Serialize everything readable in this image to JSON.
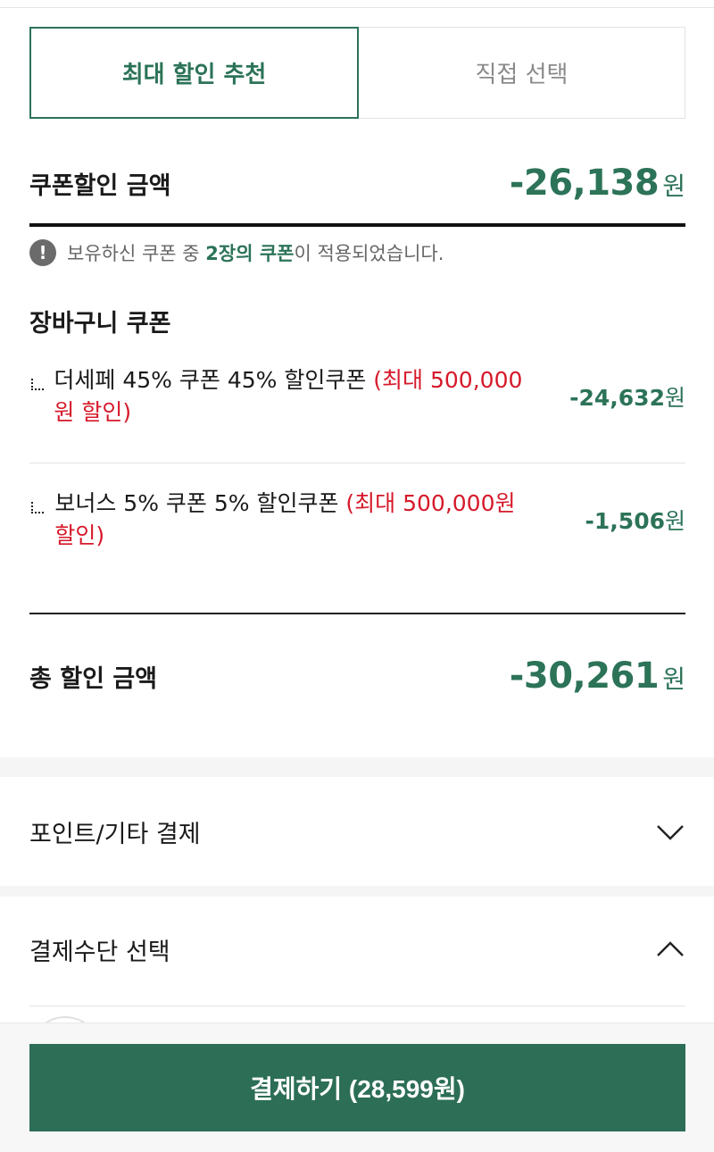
{
  "tabs": [
    {
      "label": "최대 할인 추천",
      "active": true
    },
    {
      "label": "직접 선택",
      "active": false
    }
  ],
  "coupon_discount": {
    "label": "쿠폰할인 금액",
    "amount": "-26,138",
    "unit": "원"
  },
  "notice": {
    "prefix": "보유하신 쿠폰 중 ",
    "highlight": "2장의 쿠폰",
    "suffix": "이 적용되었습니다.",
    "icon": "exclamation-icon"
  },
  "cart_coupons": {
    "title": "장바구니 쿠폰",
    "items": [
      {
        "name": "더세페 45% 쿠폰 45% 할인쿠폰 ",
        "max": "(최대 500,000원 할인)",
        "amount": "-24,632",
        "unit": "원"
      },
      {
        "name": "보너스 5% 쿠폰 5% 할인쿠폰 ",
        "max": "(최대 500,000원 할인)",
        "amount": "-1,506",
        "unit": "원"
      }
    ]
  },
  "total_discount": {
    "label": "총 할인 금액",
    "amount": "-30,261",
    "unit": "원"
  },
  "sections": {
    "points": {
      "label": "포인트/기타 결제",
      "expanded": false,
      "icon": "chevron-down-icon"
    },
    "payment_method": {
      "label": "결제수단 선택",
      "expanded": true,
      "icon": "chevron-up-icon"
    }
  },
  "pay_button": {
    "label": "결제하기 (28,599원)"
  },
  "colors": {
    "accent": "#2c7358",
    "button": "#2c6e56",
    "max_red": "#d6192a"
  }
}
